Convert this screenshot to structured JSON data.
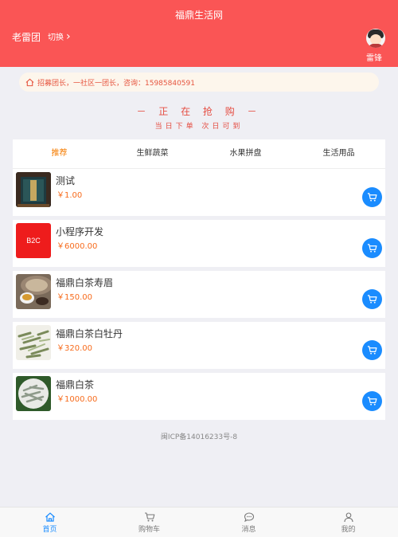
{
  "header": {
    "title": "福鼎生活网",
    "community": "老雷团",
    "switch_label": "切换",
    "user_name": "雷锋"
  },
  "notice": {
    "text": "招募团长，一社区一团长，咨询：15985840591"
  },
  "promo": {
    "main": "－  正 在 抢 购  －",
    "sub": "当日下单  次日可到"
  },
  "tabs": [
    {
      "label": "推荐",
      "active": true
    },
    {
      "label": "生鲜蔬菜",
      "active": false
    },
    {
      "label": "水果拼盘",
      "active": false
    },
    {
      "label": "生活用品",
      "active": false
    }
  ],
  "products": [
    {
      "name": "测试",
      "price": "￥1.00"
    },
    {
      "name": "小程序开发",
      "price": "￥6000.00",
      "thumb_text": "B2C"
    },
    {
      "name": "福鼎白茶寿眉",
      "price": "￥150.00"
    },
    {
      "name": "福鼎白茶白牡丹",
      "price": "￥320.00"
    },
    {
      "name": "福鼎白茶",
      "price": "￥1000.00"
    }
  ],
  "footer": {
    "icp": "闽ICP备14016233号-8"
  },
  "tabbar": [
    {
      "label": "首页",
      "icon": "home-icon",
      "active": true
    },
    {
      "label": "购物车",
      "icon": "cart-icon",
      "active": false
    },
    {
      "label": "消息",
      "icon": "message-icon",
      "active": false
    },
    {
      "label": "我的",
      "icon": "user-icon",
      "active": false
    }
  ],
  "colors": {
    "brand": "#fa5555",
    "accent": "#1a8cff",
    "price": "#f76b1c"
  }
}
